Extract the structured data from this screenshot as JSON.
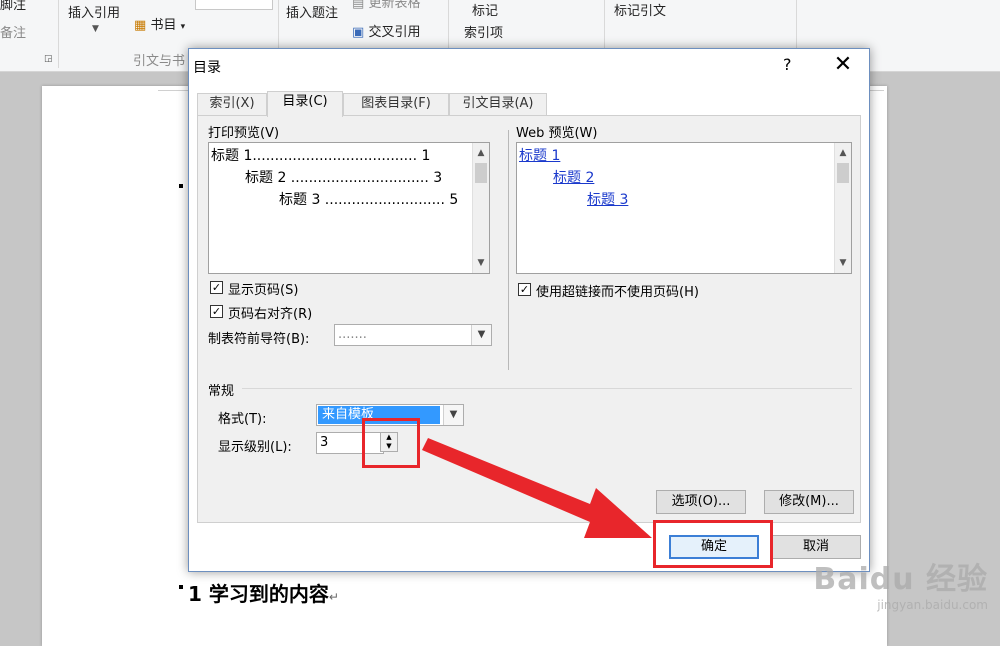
{
  "ribbon": {
    "footnote_label": "脚注",
    "note_label": "备注",
    "insert_citation": "插入引用",
    "bibliography": "书目",
    "citation_group": "引文与书",
    "insert_caption": "插入题注",
    "update_table": "更新表格",
    "cross_reference": "交叉引用",
    "mark_entry_line1": "标记",
    "mark_entry_line2": "索引项",
    "mark_citation": "标记引文"
  },
  "dialog": {
    "title": "目录",
    "help": "?",
    "close": "✕",
    "tabs": [
      {
        "label": "索引(X)"
      },
      {
        "label": "目录(C)"
      },
      {
        "label": "图表目录(F)"
      },
      {
        "label": "引文目录(A)"
      }
    ],
    "print_preview": {
      "label": "打印预览(V)",
      "lines": [
        "标题 1..................................... 1",
        "标题 2 ............................... 3",
        "标题 3 ........................... 5"
      ]
    },
    "web_preview": {
      "label": "Web 预览(W)",
      "lines": [
        "标题 1",
        "标题 2",
        "标题 3"
      ]
    },
    "show_page_numbers": {
      "label": "显示页码(S)",
      "checked": true
    },
    "right_align": {
      "label": "页码右对齐(R)",
      "checked": true
    },
    "tab_leader": {
      "label": "制表符前导符(B):",
      "value": "......."
    },
    "use_hyperlinks": {
      "label": "使用超链接而不使用页码(H)",
      "checked": true
    },
    "general": {
      "label": "常规",
      "format_label": "格式(T):",
      "format_value": "来自模板",
      "levels_label": "显示级别(L):",
      "levels_value": "3"
    },
    "options_button": "选项(O)...",
    "modify_button": "修改(M)...",
    "ok_button": "确定",
    "cancel_button": "取消"
  },
  "document": {
    "heading": "1 学习到的内容"
  },
  "watermark": {
    "logo": "Baidu 经验",
    "url": "jingyan.baidu.com"
  },
  "colors": {
    "highlight": "#e8262b",
    "link": "#1a39cc",
    "selection": "#3399ff"
  }
}
